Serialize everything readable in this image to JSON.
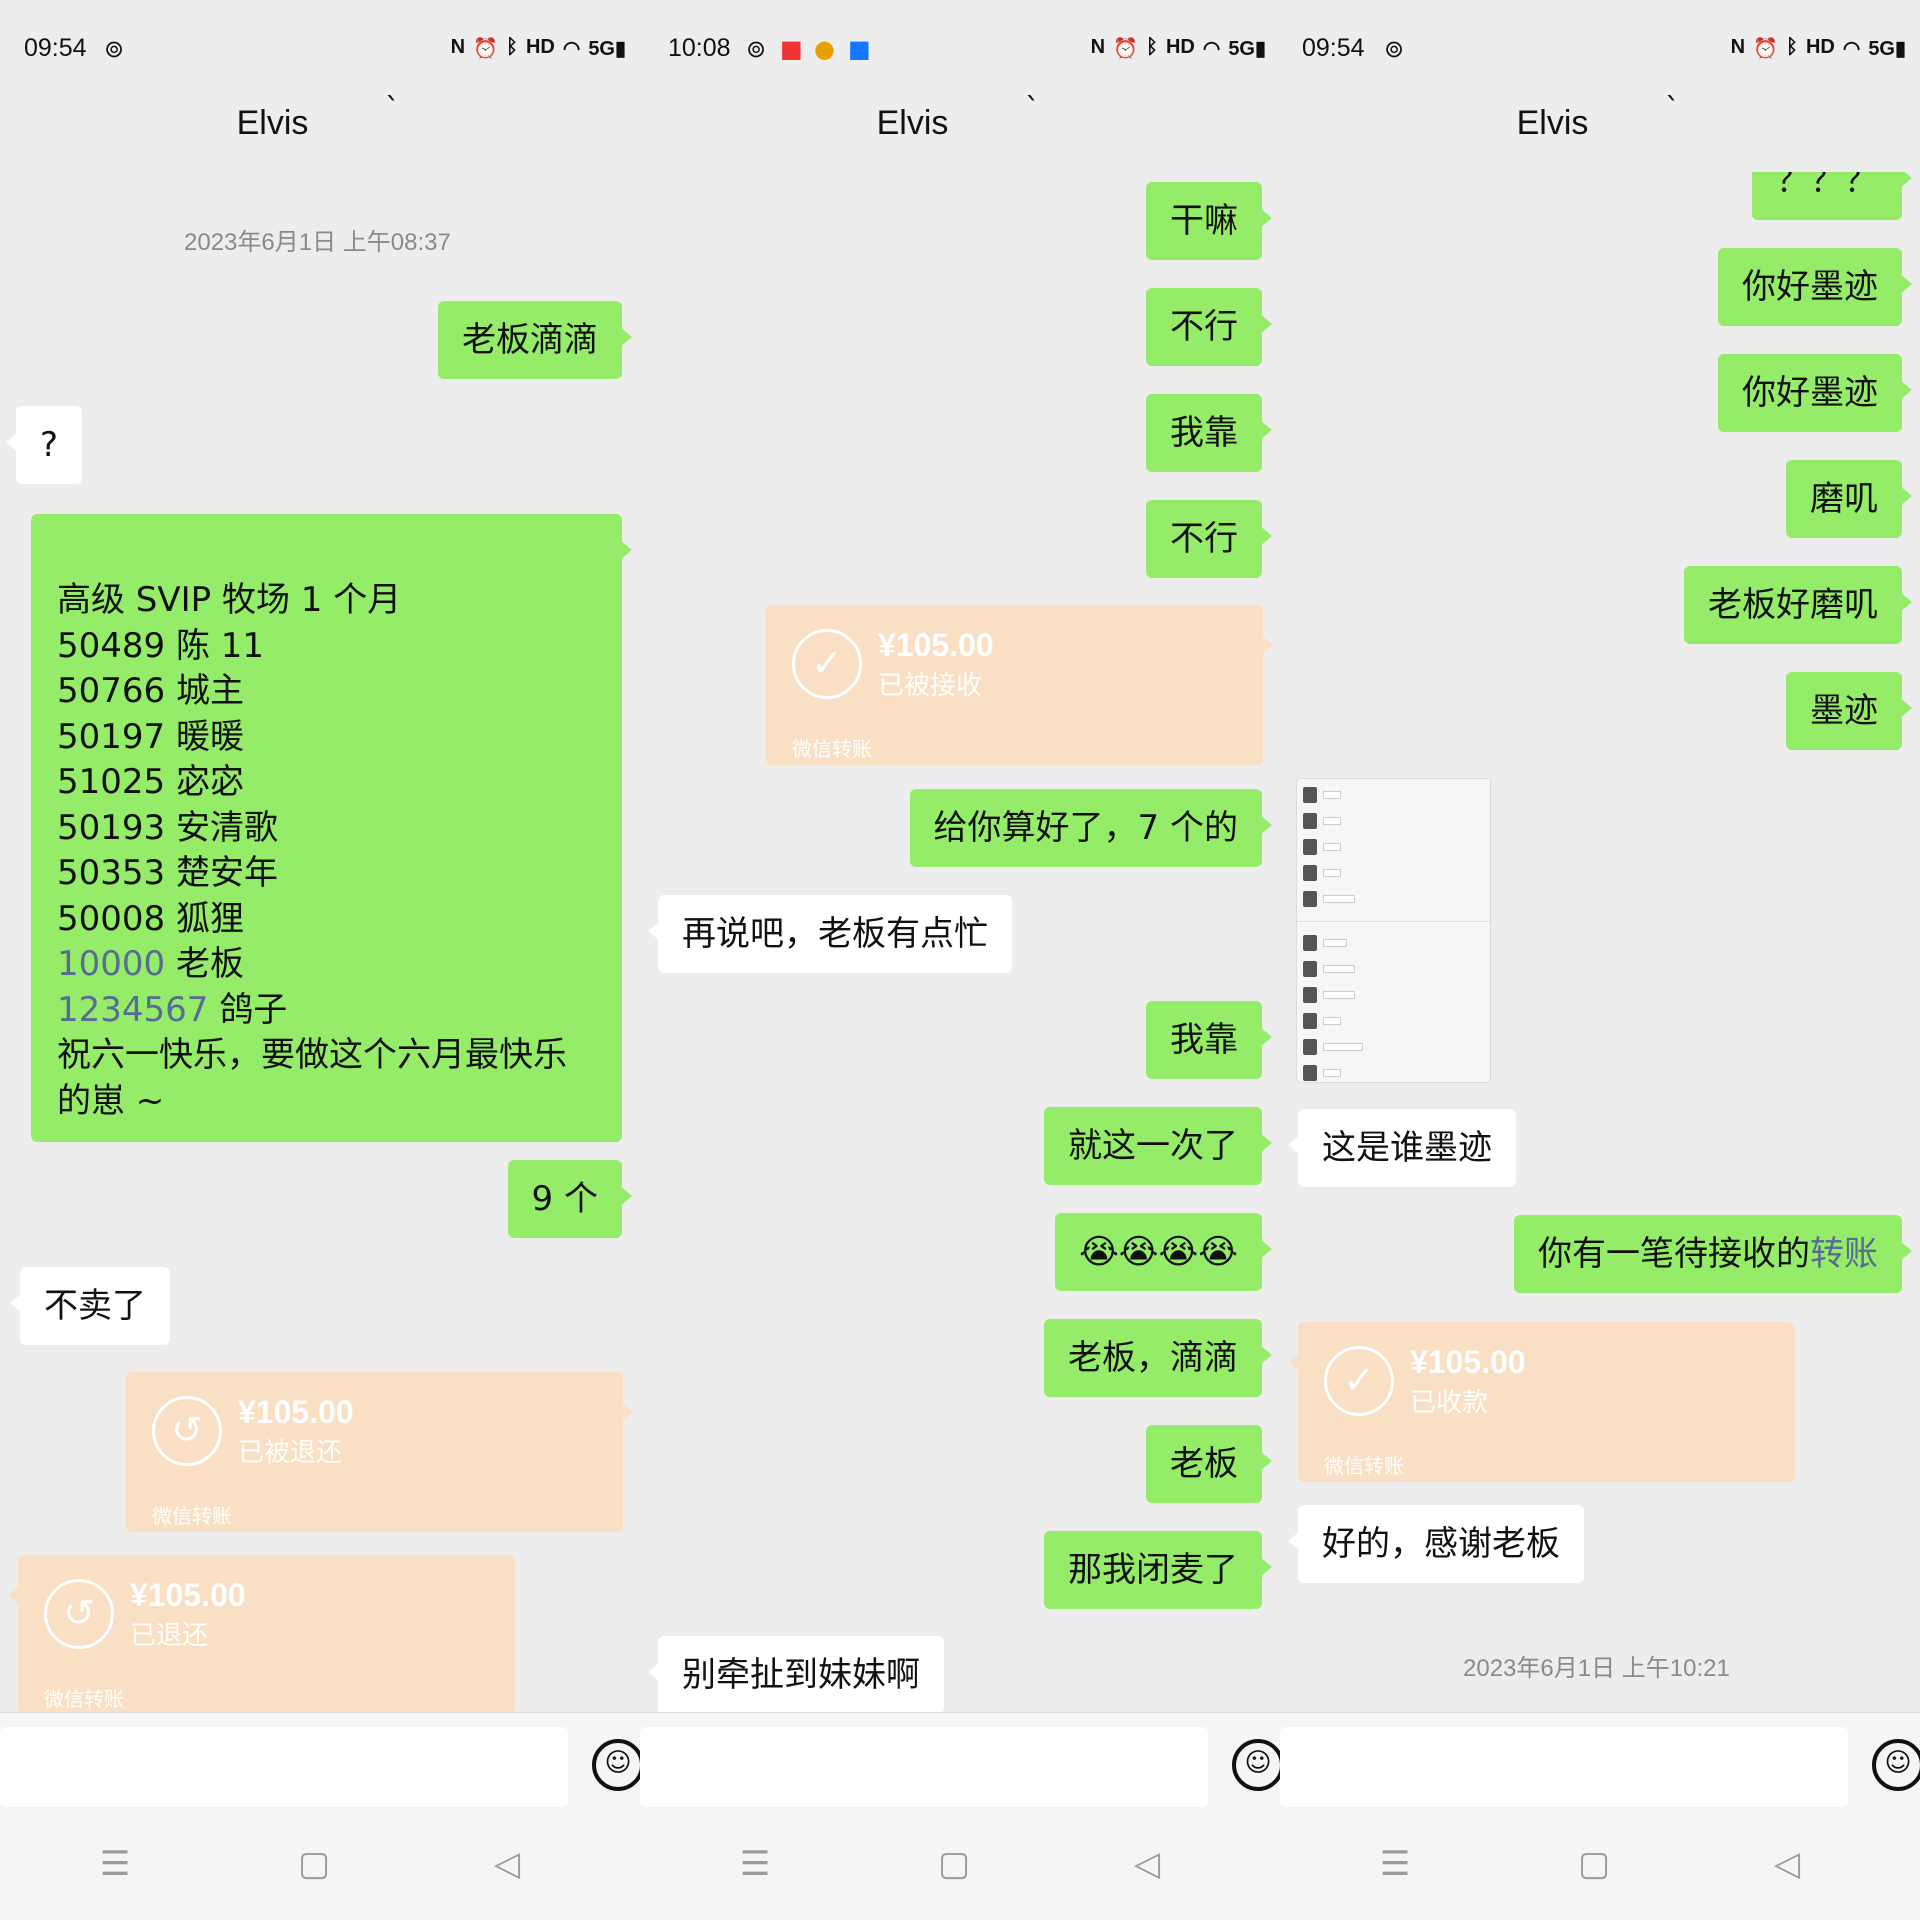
{
  "panels": [
    {
      "status": {
        "time": "09:54"
      },
      "header": {
        "title": "Elvis",
        "mark": "`"
      },
      "timestamp": "2023年6月1日 上午08:37",
      "messages": {
        "m1": "老板滴滴",
        "m2": "?",
        "long": [
          "高级 SVIP 牧场 1 个月",
          "50489   陈 11",
          "50766  城主",
          "50197  暖暖",
          "51025  宓宓",
          "50193  安清歌",
          "50353  楚安年",
          "50008  狐狸",
          "10000",
          "老板",
          "1234567",
          "鸽子",
          "祝六一快乐，要做这个六月最快乐",
          "的崽 ~"
        ],
        "m3": "9 个",
        "m4": "不卖了"
      },
      "transfers": [
        {
          "amount": "¥105.00",
          "status": "已被退还",
          "footer": "微信转账",
          "icon": "return-icon"
        },
        {
          "amount": "¥105.00",
          "status": "已退还",
          "footer": "微信转账",
          "icon": "return-icon"
        }
      ]
    },
    {
      "status": {
        "time": "10:08"
      },
      "header": {
        "title": "Elvis",
        "mark": "`"
      },
      "messages": {
        "m1": "干嘛",
        "m2": "不行",
        "m3": "我靠",
        "m4": "不行",
        "m5": "给你算好了，7 个的",
        "m6": "再说吧，老板有点忙",
        "m7": "我靠",
        "m8": "就这一次了",
        "m9": "😭😭😭😭",
        "m10": "老板，滴滴",
        "m11": "老板",
        "m12": "那我闭麦了",
        "m13": "别牵扯到妹妹啊"
      },
      "transfers": [
        {
          "amount": "¥105.00",
          "status": "已被接收",
          "footer": "微信转账",
          "icon": "check-icon"
        }
      ]
    },
    {
      "status": {
        "time": "09:54"
      },
      "header": {
        "title": "Elvis",
        "mark": "`"
      },
      "timestamp": "2023年6月1日 上午10:21",
      "messages": {
        "m0": "？？？",
        "m1": "你好墨迹",
        "m2": "你好墨迹",
        "m3": "磨叽",
        "m4": "老板好磨叽",
        "m5": "墨迹",
        "m6": "这是谁墨迹",
        "m7a": "你有一笔待接收的",
        "m7b": "转账",
        "m8": "好的，感谢老板"
      },
      "transfers": [
        {
          "amount": "¥105.00",
          "status": "已收款",
          "footer": "微信转账",
          "icon": "check-icon"
        }
      ]
    }
  ],
  "colors": {
    "green_bubble": "#95ec69",
    "transfer": "#f9dfc3",
    "background": "#ededed",
    "link": "#576b95"
  },
  "icons": {
    "status": [
      "nfc-icon",
      "alarm-icon",
      "bluetooth-icon",
      "hd-icon",
      "wifi-icon",
      "signal-5g-icon"
    ],
    "input": "emoji-icon",
    "nav": [
      "menu-icon",
      "home-icon",
      "back-icon"
    ]
  }
}
